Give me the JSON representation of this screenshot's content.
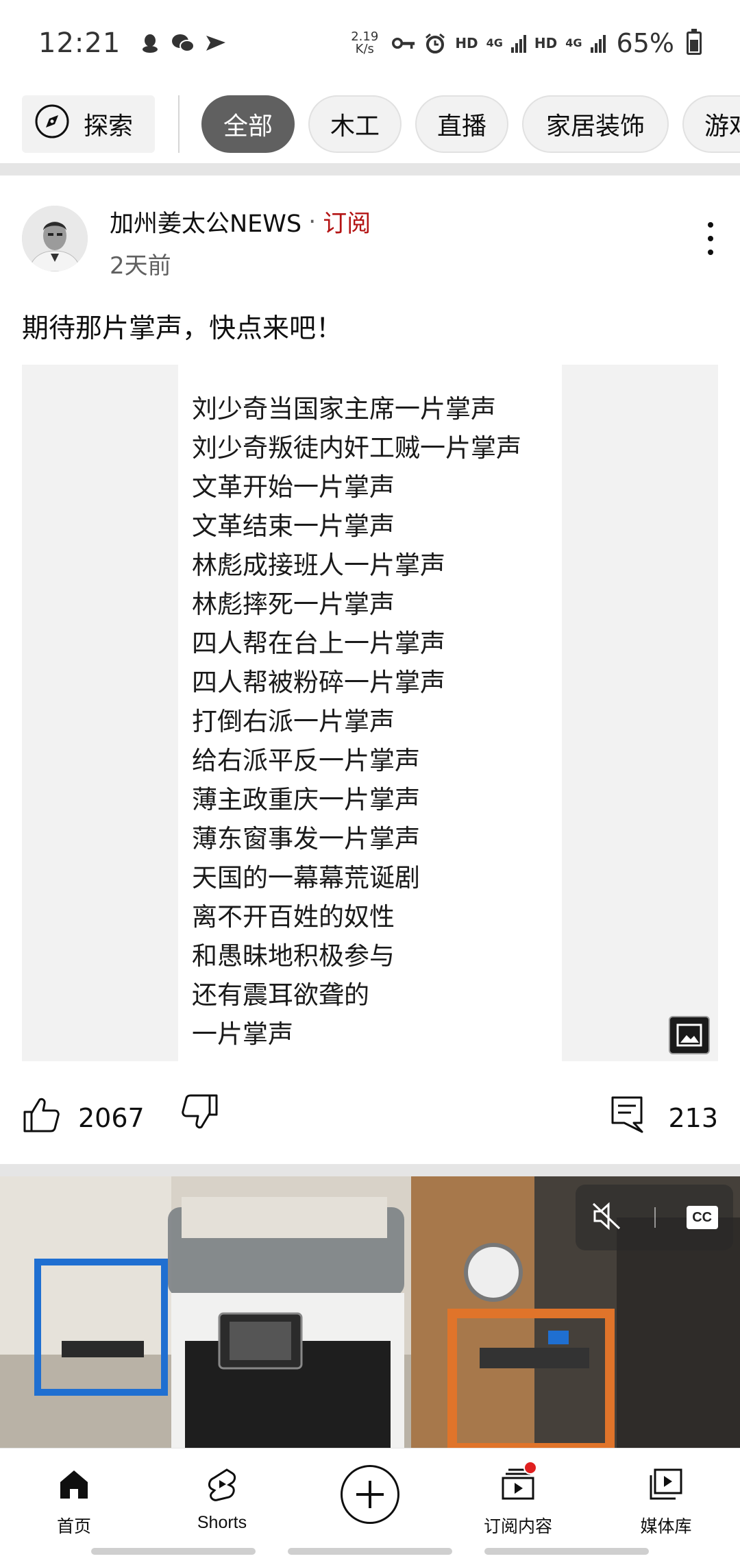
{
  "status_bar": {
    "time": "12:21",
    "net_speed_value": "2.19",
    "net_speed_unit": "K/s",
    "hd1": "HD",
    "net1": "4G",
    "hd2": "HD",
    "net2": "4G",
    "battery": "65%",
    "battery_level": 0.65
  },
  "chips": {
    "explore_label": "探索",
    "items": [
      "全部",
      "木工",
      "直播",
      "家居装饰",
      "游戏"
    ],
    "selected": "全部"
  },
  "post": {
    "channel_name": "加州姜太公NEWS",
    "separator": "·",
    "subscribe_label": "订阅",
    "time": "2天前",
    "text": "期待那片掌声，快点来吧！",
    "image_lines": [
      "刘少奇当国家主席一片掌声",
      "刘少奇叛徒内奸工贼一片掌声",
      "文革开始一片掌声",
      "文革结束一片掌声",
      "林彪成接班人一片掌声",
      "林彪摔死一片掌声",
      "四人帮在台上一片掌声",
      "四人帮被粉碎一片掌声",
      "打倒右派一片掌声",
      "给右派平反一片掌声",
      "薄主政重庆一片掌声",
      "薄东窗事发一片掌声",
      "天国的一幕幕荒诞剧",
      "离不开百姓的奴性",
      "和愚昧地积极参与",
      "还有震耳欲聋的",
      "一片掌声"
    ],
    "likes": "2067",
    "comments": "213"
  },
  "video": {
    "cc_label": "CC"
  },
  "bottom_nav": {
    "home": "首页",
    "shorts": "Shorts",
    "subscriptions": "订阅内容",
    "library": "媒体库"
  },
  "colors": {
    "subscribe_red": "#b41414",
    "active_chip": "#606060",
    "notification": "#e02020"
  }
}
